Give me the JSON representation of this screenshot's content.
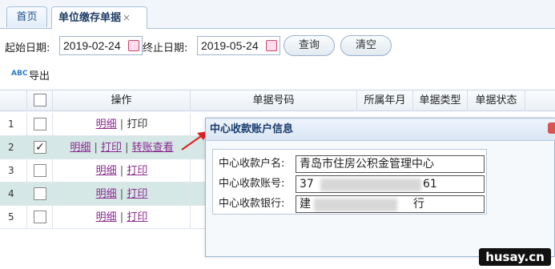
{
  "tabs": [
    {
      "label": "首页"
    },
    {
      "label": "单位缴存单据",
      "close": "×"
    }
  ],
  "toolbar": {
    "start_label": "起始日期:",
    "start_value": "2019-02-24",
    "end_label": "终止日期:",
    "end_value": "2019-05-24",
    "query_label": "查询",
    "clear_label": "清空",
    "export_label": "导出",
    "export_icon_text": "ABC"
  },
  "grid": {
    "headers": [
      "操作",
      "单据号码",
      "所属年月",
      "单据类型",
      "单据状态"
    ],
    "rows": [
      {
        "num": "1",
        "checked": false,
        "ops": [
          "明细",
          "打印"
        ]
      },
      {
        "num": "2",
        "checked": true,
        "ops": [
          "明细",
          "打印",
          "转账查看"
        ]
      },
      {
        "num": "3",
        "checked": false,
        "ops": [
          "明细",
          "打印"
        ]
      },
      {
        "num": "4",
        "checked": false,
        "ops": [
          "明细",
          "打印"
        ]
      },
      {
        "num": "5",
        "checked": false,
        "ops": [
          "明细",
          "打印"
        ]
      }
    ],
    "check_mark": "✓"
  },
  "popup": {
    "title": "中心收款账户信息",
    "fields": [
      {
        "label": "中心收款户名:",
        "value": "青岛市住房公积金管理中心"
      },
      {
        "label": "中心收款账号:",
        "value_start": "37",
        "value_end": "61"
      },
      {
        "label": "中心收款银行:",
        "value_start": "建",
        "value_end": "行"
      }
    ]
  },
  "watermark": "husay.cn"
}
